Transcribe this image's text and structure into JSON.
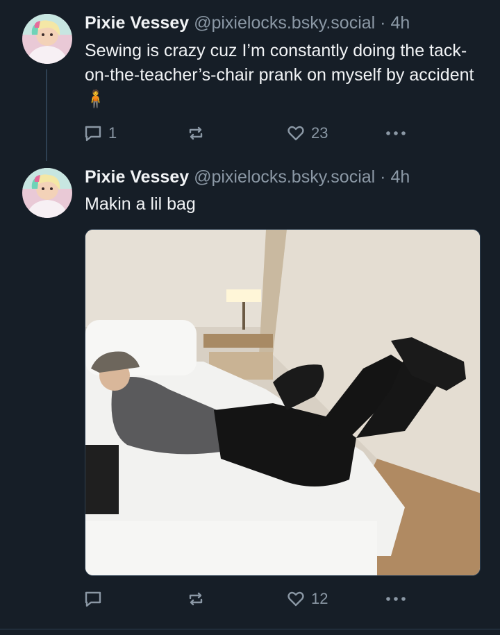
{
  "posts": [
    {
      "author_name": "Pixie Vessey",
      "handle": "@pixielocks.bsky.social",
      "separator": "·",
      "time": "4h",
      "text": "Sewing is crazy cuz I’m constantly doing the tack-on-the-teacher’s-chair prank on myself by accident 🧍",
      "reply_count": "1",
      "repost_count": "",
      "like_count": "23"
    },
    {
      "author_name": "Pixie Vessey",
      "handle": "@pixielocks.bsky.social",
      "separator": "·",
      "time": "4h",
      "text": "Makin a lil bag",
      "reply_count": "",
      "repost_count": "",
      "like_count": "12"
    }
  ],
  "icons": {
    "reply": "speech-bubble-icon",
    "repost": "repost-arrows-icon",
    "like": "heart-outline-icon",
    "more": "ellipsis-icon"
  },
  "colors": {
    "background": "#161e27",
    "text_primary": "#f1f3f5",
    "text_secondary": "#8b98a5",
    "divider": "#2e4052"
  }
}
